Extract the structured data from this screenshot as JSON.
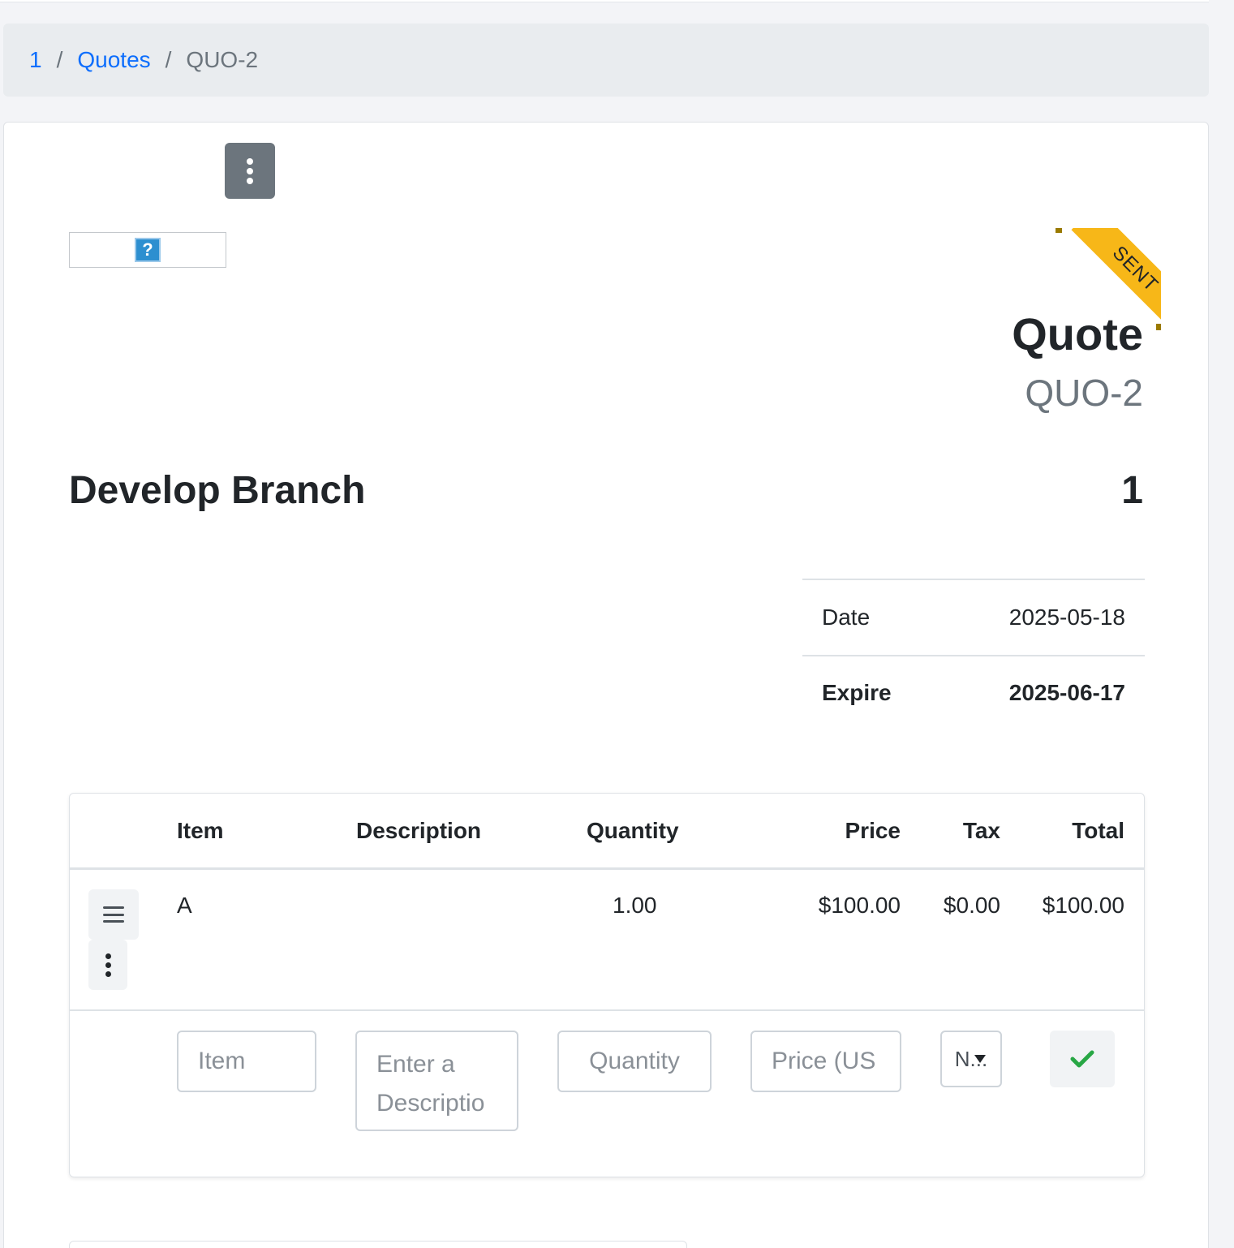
{
  "breadcrumb": {
    "items": [
      {
        "label": "1"
      },
      {
        "label": "Quotes"
      }
    ],
    "separator": "/",
    "current": "QUO-2"
  },
  "status_ribbon": "SENT",
  "document": {
    "title": "Quote",
    "number": "QUO-2",
    "company_name": "Develop Branch",
    "client_name": "1"
  },
  "meta": {
    "date_label": "Date",
    "date_value": "2025-05-18",
    "expire_label": "Expire",
    "expire_value": "2025-06-17"
  },
  "items_table": {
    "headers": {
      "item": "Item",
      "description": "Description",
      "quantity": "Quantity",
      "price": "Price",
      "tax": "Tax",
      "total": "Total"
    },
    "rows": [
      {
        "item": "A",
        "description": "",
        "quantity": "1.00",
        "price": "$100.00",
        "tax": "$0.00",
        "total": "$100.00"
      }
    ],
    "new_row": {
      "item_placeholder": "Item",
      "description_placeholder": "Enter a Descriptio",
      "quantity_placeholder": "Quantity",
      "price_placeholder": "Price (US",
      "tax_selected": "N..."
    }
  },
  "icons": {
    "more": "kebab-vertical",
    "drag": "hamburger",
    "confirm": "check",
    "logo_placeholder": "question-mark"
  },
  "colors": {
    "link": "#0d6efd",
    "ribbon": "#f7b718",
    "secondary_button": "#6c757d",
    "success": "#28a745"
  }
}
